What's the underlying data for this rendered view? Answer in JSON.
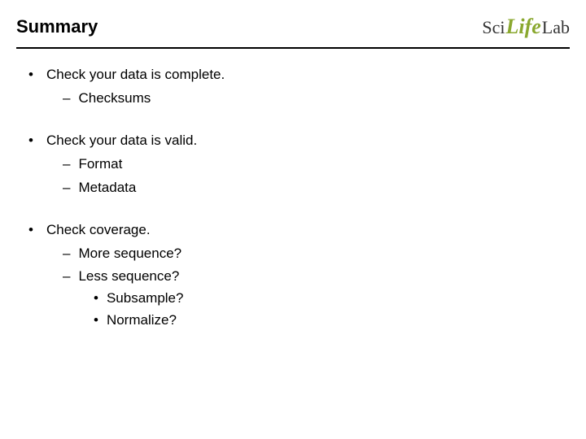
{
  "header": {
    "title": "Summary",
    "logo": {
      "part1": "Sci",
      "part2": "Life",
      "part3": "Lab"
    }
  },
  "bullets": [
    {
      "text": "Check your data is complete.",
      "children": [
        {
          "text": "Checksums",
          "children": []
        }
      ]
    },
    {
      "text": "Check your data is valid.",
      "children": [
        {
          "text": "Format",
          "children": []
        },
        {
          "text": "Metadata",
          "children": []
        }
      ]
    },
    {
      "text": "Check coverage.",
      "children": [
        {
          "text": "More sequence?",
          "children": []
        },
        {
          "text": "Less sequence?",
          "children": [
            {
              "text": "Subsample?"
            },
            {
              "text": "Normalize?"
            }
          ]
        }
      ]
    }
  ]
}
